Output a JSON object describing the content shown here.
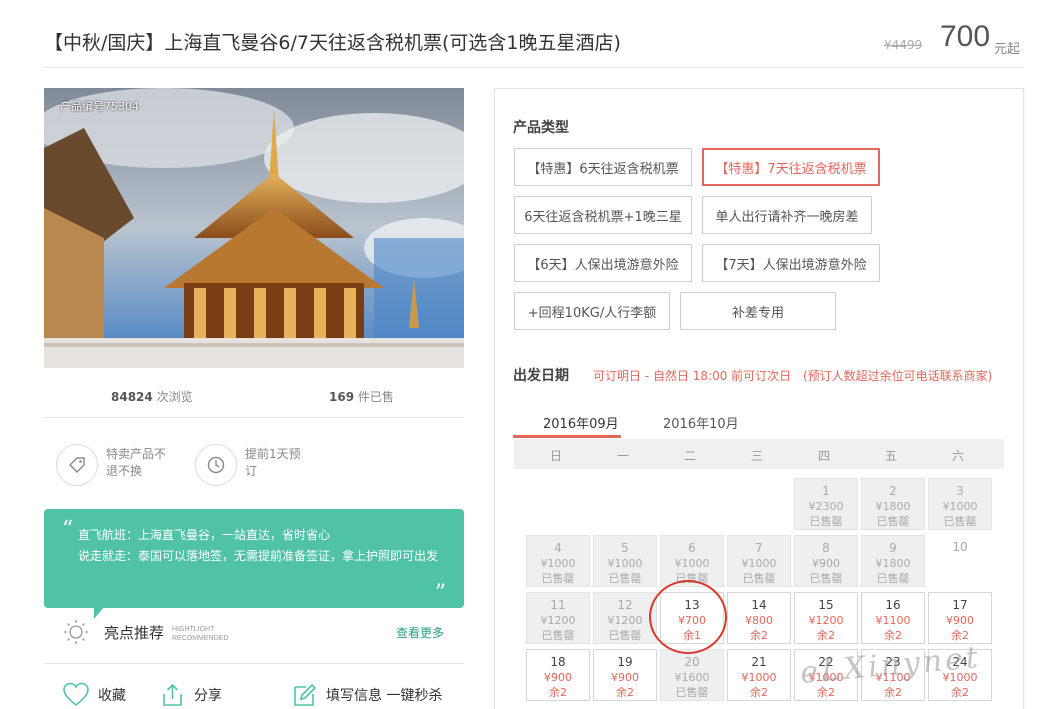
{
  "header": {
    "title": "【中秋/国庆】上海直飞曼谷6/7天往返含税机票(可选含1晚五星酒店)",
    "price_old": "¥4499",
    "price": "700",
    "price_unit": "元起"
  },
  "product": {
    "id_label": "产品编号75304",
    "views_count": "84824",
    "views_label": "次浏览",
    "sold_count": "169",
    "sold_label": "件已售"
  },
  "features": [
    {
      "icon": "tag-icon",
      "text": "特卖产品不退不换"
    },
    {
      "icon": "clock-icon",
      "text": "提前1天预订"
    }
  ],
  "quote": {
    "line1": "直飞航班：上海直飞曼谷，一站直达，省时省心",
    "line2": "说走就走：泰国可以落地签，无需提前准备签证，拿上护照即可出发"
  },
  "highlight": {
    "title": "亮点推荐",
    "en_line1": "HIGHTLIGHT",
    "en_line2": "RECOMMENDED",
    "more": "查看更多"
  },
  "actions": {
    "favorite": "收藏",
    "share": "分享",
    "fill_info": "填写信息 一键秒杀"
  },
  "product_type": {
    "title": "产品类型",
    "options": [
      "【特惠】6天往返含税机票",
      "【特惠】7天往返含税机票",
      "6天往返含税机票+1晚三星",
      "单人出行请补齐一晚房差",
      "【6天】人保出境游意外险",
      "【7天】人保出境游意外险",
      "+回程10KG/人行李额",
      "补差专用"
    ],
    "selected_index": 1
  },
  "departure": {
    "title": "出发日期",
    "note1": "可订明日 - 自然日 18:00 前可订次日",
    "note2": "(预订人数超过余位可电话联系商家)",
    "months": [
      "2016年09月",
      "2016年10月"
    ],
    "weekdays": [
      "日",
      "一",
      "二",
      "三",
      "四",
      "五",
      "六"
    ],
    "calendar": [
      {
        "day": "1",
        "price": "¥2300",
        "status": "已售罄",
        "state": "sold"
      },
      {
        "day": "2",
        "price": "¥1800",
        "status": "已售罄",
        "state": "sold"
      },
      {
        "day": "3",
        "price": "¥1000",
        "status": "已售罄",
        "state": "sold"
      },
      {
        "day": "4",
        "price": "¥1000",
        "status": "已售罄",
        "state": "sold"
      },
      {
        "day": "5",
        "price": "¥1000",
        "status": "已售罄",
        "state": "sold"
      },
      {
        "day": "6",
        "price": "¥1000",
        "status": "已售罄",
        "state": "sold"
      },
      {
        "day": "7",
        "price": "¥1000",
        "status": "已售罄",
        "state": "sold"
      },
      {
        "day": "8",
        "price": "¥900",
        "status": "已售罄",
        "state": "sold"
      },
      {
        "day": "9",
        "price": "¥1800",
        "status": "已售罄",
        "state": "sold"
      },
      {
        "day": "10",
        "price": "",
        "status": "",
        "state": "empty"
      },
      {
        "day": "11",
        "price": "¥1200",
        "status": "已售罄",
        "state": "sold"
      },
      {
        "day": "12",
        "price": "¥1200",
        "status": "已售罄",
        "state": "sold"
      },
      {
        "day": "13",
        "price": "¥700",
        "status": "余1",
        "state": "open"
      },
      {
        "day": "14",
        "price": "¥800",
        "status": "余2",
        "state": "open"
      },
      {
        "day": "15",
        "price": "¥1200",
        "status": "余2",
        "state": "open"
      },
      {
        "day": "16",
        "price": "¥1100",
        "status": "余2",
        "state": "open"
      },
      {
        "day": "17",
        "price": "¥900",
        "status": "余2",
        "state": "open"
      },
      {
        "day": "18",
        "price": "¥900",
        "status": "余2",
        "state": "open"
      },
      {
        "day": "19",
        "price": "¥900",
        "status": "余2",
        "state": "open"
      },
      {
        "day": "20",
        "price": "¥1600",
        "status": "已售罄",
        "state": "sold"
      },
      {
        "day": "21",
        "price": "¥1000",
        "status": "余2",
        "state": "open"
      },
      {
        "day": "22",
        "price": "¥1000",
        "status": "余2",
        "state": "open"
      },
      {
        "day": "23",
        "price": "¥1100",
        "status": "余2",
        "state": "open"
      },
      {
        "day": "24",
        "price": "¥1000",
        "status": "余2",
        "state": "open"
      }
    ]
  },
  "watermark": "eLXinynet",
  "colors": {
    "accent": "#e4675a",
    "teal": "#50c3a6",
    "annotation_red": "#d9372c"
  }
}
